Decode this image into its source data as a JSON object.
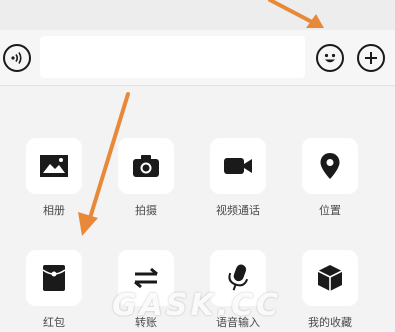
{
  "input_bar": {
    "voice_icon": "voice-icon",
    "emoji_icon": "smiley-icon",
    "plus_icon": "plus-icon",
    "input_value": ""
  },
  "panel": {
    "items": [
      {
        "label": "相册",
        "icon": "photo-icon"
      },
      {
        "label": "拍摄",
        "icon": "camera-icon"
      },
      {
        "label": "视频通话",
        "icon": "video-call-icon"
      },
      {
        "label": "位置",
        "icon": "location-icon"
      },
      {
        "label": "红包",
        "icon": "red-packet-icon"
      },
      {
        "label": "转账",
        "icon": "transfer-icon"
      },
      {
        "label": "语音输入",
        "icon": "microphone-icon"
      },
      {
        "label": "我的收藏",
        "icon": "favorites-cube-icon"
      }
    ]
  },
  "overlay": {
    "arrow_color": "#e8893a",
    "watermark": "GASK.CC"
  }
}
